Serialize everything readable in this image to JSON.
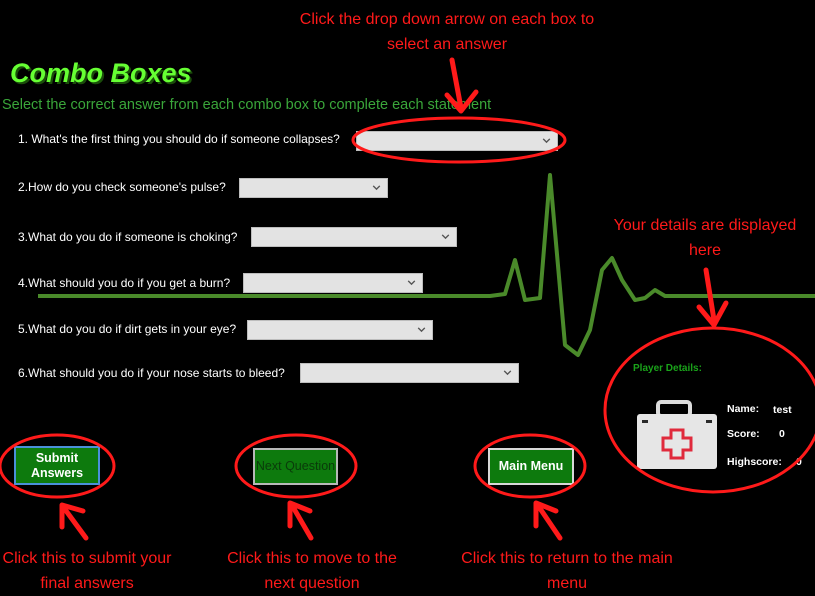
{
  "header": {
    "title": "Combo Boxes",
    "subtitle": "Select the correct answer from each combo box to complete each statement"
  },
  "questions": [
    {
      "label": "1. What's the first thing you should do if someone collapses?",
      "selected": ""
    },
    {
      "label": "2.How do you check someone's pulse?",
      "selected": ""
    },
    {
      "label": "3.What do you do if someone is choking?",
      "selected": ""
    },
    {
      "label": "4.What should you do if you get a burn?",
      "selected": ""
    },
    {
      "label": "5.What do you do if dirt gets in your eye?",
      "selected": ""
    },
    {
      "label": "6.What should you do if your nose starts to bleed?",
      "selected": ""
    }
  ],
  "buttons": {
    "submit": "Submit Answers",
    "next": "Next Question",
    "menu": "Main Menu"
  },
  "player": {
    "title": "Player Details:",
    "name_label": "Name:",
    "name_value": "test",
    "score_label": "Score:",
    "score_value": "0",
    "highscore_label": "Highscore:",
    "highscore_value": "0"
  },
  "callouts": {
    "dropdown": "Click the drop down arrow on each box to select an answer",
    "details": "Your details are displayed here",
    "submit": "Click this to submit your final answers",
    "next": "Click this to move to the next question",
    "menu": "Click this to return to the main menu"
  },
  "icons": {
    "chevron": "chevron-down-icon",
    "medkit": "first-aid-kit-icon"
  },
  "colors": {
    "background": "#000000",
    "title": "#66ff33",
    "button": "#0d7a0d",
    "callout": "#ff1a1a",
    "heartbeat": "#4a8a2a"
  }
}
